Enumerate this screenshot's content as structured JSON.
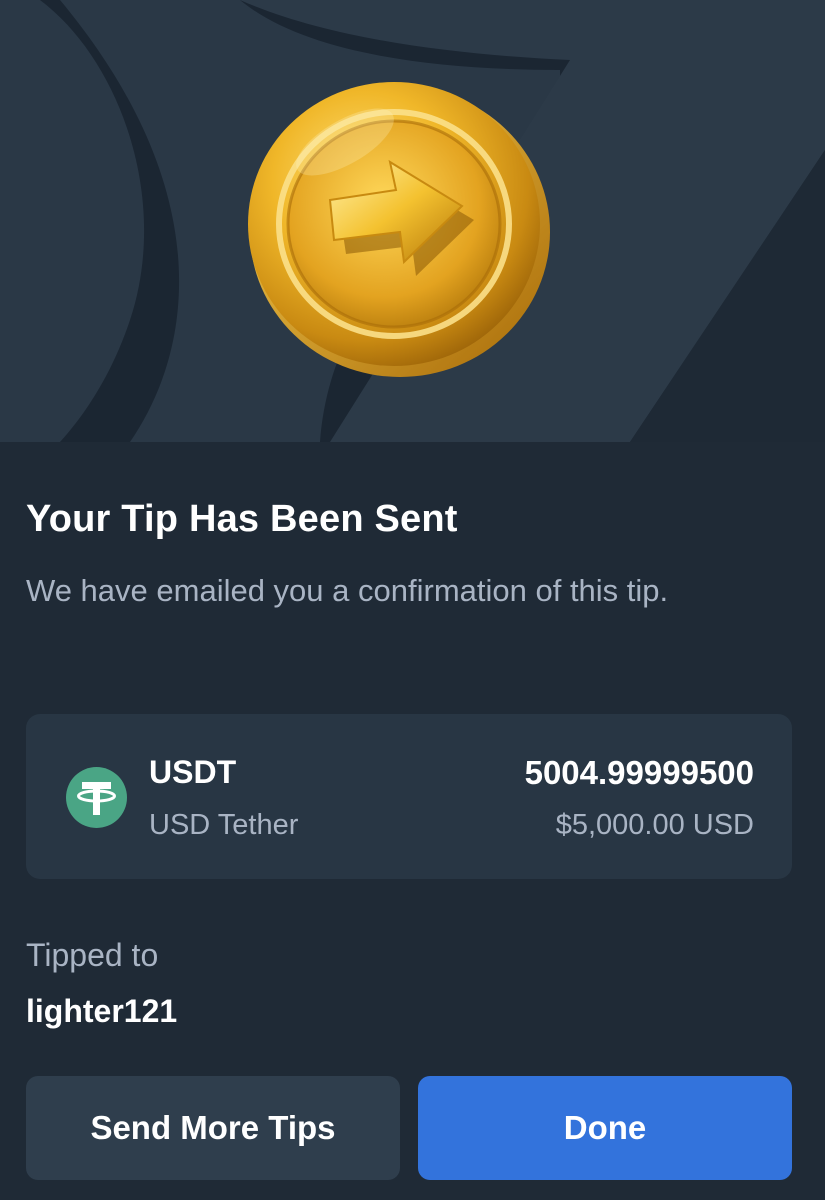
{
  "hero": {
    "icon": "gold-coin-arrow-icon",
    "colors": {
      "background_dark": "#1b2632",
      "background_shape": "#2a3846",
      "coin_gold": "#e8b024"
    }
  },
  "confirmation": {
    "title": "Your Tip Has Been Sent",
    "subtitle": "We have emailed you a confirmation of this tip."
  },
  "token": {
    "icon": "tether-icon",
    "icon_color": "#4aa585",
    "symbol": "USDT",
    "name": "USD Tether",
    "amount": "5004.99999500",
    "fiat_value": "$5,000.00 USD"
  },
  "recipient": {
    "label": "Tipped to",
    "username": "lighter121"
  },
  "actions": {
    "send_more_label": "Send More Tips",
    "done_label": "Done",
    "primary_color": "#3373dc"
  }
}
